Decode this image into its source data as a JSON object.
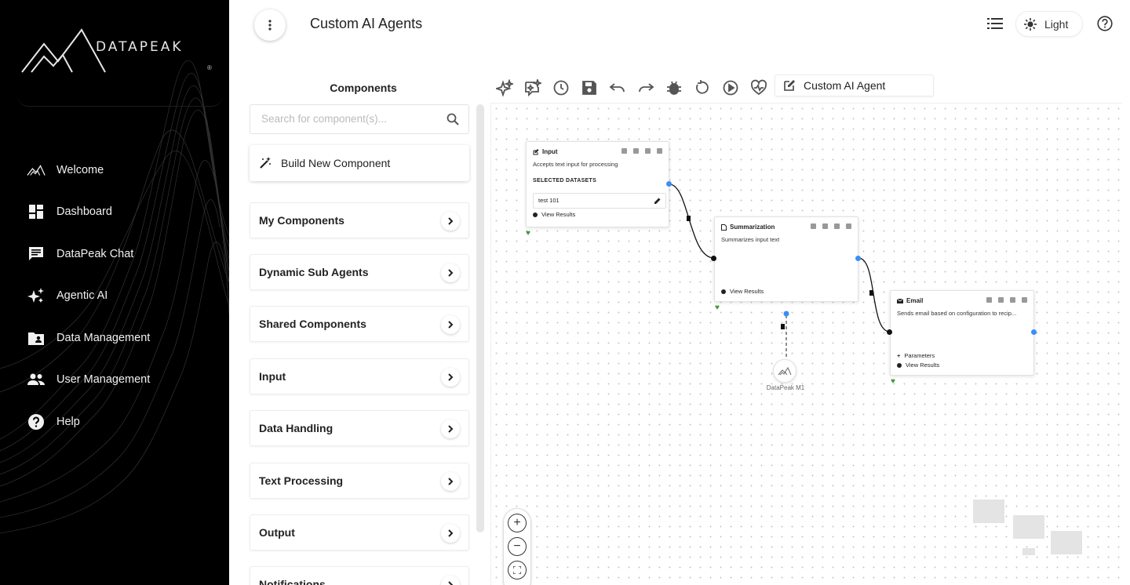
{
  "brand": {
    "name": "DATAPEAK",
    "reg": "®"
  },
  "sidebar": {
    "items": [
      {
        "label": "Welcome",
        "icon": "mountain-icon"
      },
      {
        "label": "Dashboard",
        "icon": "dashboard-icon"
      },
      {
        "label": "DataPeak Chat",
        "icon": "chat-icon"
      },
      {
        "label": "Agentic AI",
        "icon": "sparkle-icon"
      },
      {
        "label": "Data Management",
        "icon": "folder-user-icon"
      },
      {
        "label": "User Management",
        "icon": "people-icon"
      },
      {
        "label": "Help",
        "icon": "help-icon"
      }
    ]
  },
  "header": {
    "title": "Custom AI Agents",
    "theme_label": "Light"
  },
  "components": {
    "title": "Components",
    "search_placeholder": "Search for component(s)...",
    "build_label": "Build New Component",
    "categories": [
      "My Components",
      "Dynamic Sub Agents",
      "Shared Components",
      "Input",
      "Data Handling",
      "Text Processing",
      "Output",
      "Notifications"
    ]
  },
  "toolbar": {
    "agent_name": "Custom AI Agent"
  },
  "canvas": {
    "nodes": {
      "input": {
        "title": "Input",
        "description": "Accepts text input for processing",
        "section_label": "SELECTED DATASETS",
        "dataset": "test 101",
        "view_results": "View Results"
      },
      "summarization": {
        "title": "Summarization",
        "description": "Summarizes input text",
        "view_results": "View Results"
      },
      "email": {
        "title": "Email",
        "description": "Sends email based on configuration to recip...",
        "parameters": "Parameters",
        "view_results": "View Results"
      }
    },
    "llm_label": "DataPeak M1",
    "zoom": {
      "in": "+",
      "out": "−"
    }
  },
  "colors": {
    "sidebar_bg": "#000000",
    "port_blue": "#3b8ff5",
    "heart_green": "#3a9a3a"
  }
}
